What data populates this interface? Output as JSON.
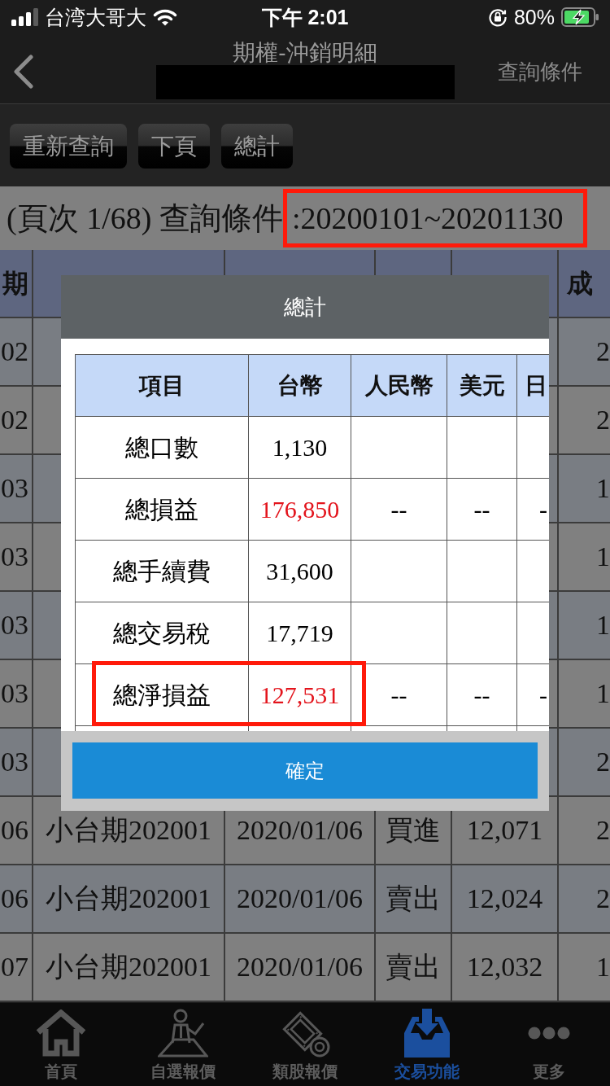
{
  "status_bar": {
    "carrier": "台湾大哥大",
    "time": "下午 2:01",
    "battery": "80%"
  },
  "nav_bar": {
    "title": "期權-沖銷明細",
    "action": "查詢條件"
  },
  "toolbar": {
    "buttons": [
      "重新查詢",
      "下頁",
      "總計"
    ]
  },
  "query_info": {
    "page": "(頁次 1/68) 查詢條件",
    "range": ":20200101~20201130",
    "highlighted": true
  },
  "table": {
    "header": {
      "column_1": "期",
      "column_6": "成"
    },
    "rows": [
      {
        "column_1": "02",
        "column_6": "2"
      },
      {
        "column_1": "02",
        "column_6": "2"
      },
      {
        "column_1": "03",
        "column_6": "1"
      },
      {
        "column_1": "03",
        "column_6": "1"
      },
      {
        "column_1": "03",
        "column_6": "1"
      },
      {
        "column_1": "03",
        "column_6": "1"
      },
      {
        "column_1": "03",
        "column_6": "2"
      },
      {
        "column_1": "06",
        "column_2": "小台期202001",
        "column_3": "2020/01/06",
        "column_4": "買進",
        "column_5": "12,071",
        "column_6": "2"
      },
      {
        "column_1": "06",
        "column_2": "小台期202001",
        "column_3": "2020/01/06",
        "column_4": "賣出",
        "column_5": "12,024",
        "column_6": "2"
      },
      {
        "column_1": "07",
        "column_2": "小台期202001",
        "column_3": "2020/01/06",
        "column_4": "賣出",
        "column_5": "12,032",
        "column_6": "1"
      }
    ]
  },
  "dialog": {
    "title": "總計",
    "columns": [
      "項目",
      "台幣",
      "人民幣",
      "美元",
      "日"
    ],
    "rows": [
      {
        "cells": [
          "總口數",
          "1,130",
          null,
          null,
          null
        ],
        "color": "#000000",
        "highlighted": false
      },
      {
        "cells": [
          "總損益",
          "176,850",
          "--",
          "--",
          "-"
        ],
        "color": "#e3141c",
        "highlighted": false
      },
      {
        "cells": [
          "總手續費",
          "31,600",
          null,
          null,
          null
        ],
        "color": "#000000",
        "highlighted": false
      },
      {
        "cells": [
          "總交易稅",
          "17,719",
          null,
          null,
          null
        ],
        "color": "#000000",
        "highlighted": false
      },
      {
        "cells": [
          "總淨損益",
          "127,531",
          "--",
          "--",
          "-"
        ],
        "color": "#e3141c",
        "highlighted": true
      }
    ],
    "confirm": "確定"
  },
  "tab_bar": {
    "items": [
      {
        "label": "首頁",
        "selected": false
      },
      {
        "label": "自選報價",
        "selected": false
      },
      {
        "label": "類股報價",
        "selected": false
      },
      {
        "label": "交易功能",
        "selected": true
      },
      {
        "label": "更多",
        "selected": false
      }
    ]
  }
}
